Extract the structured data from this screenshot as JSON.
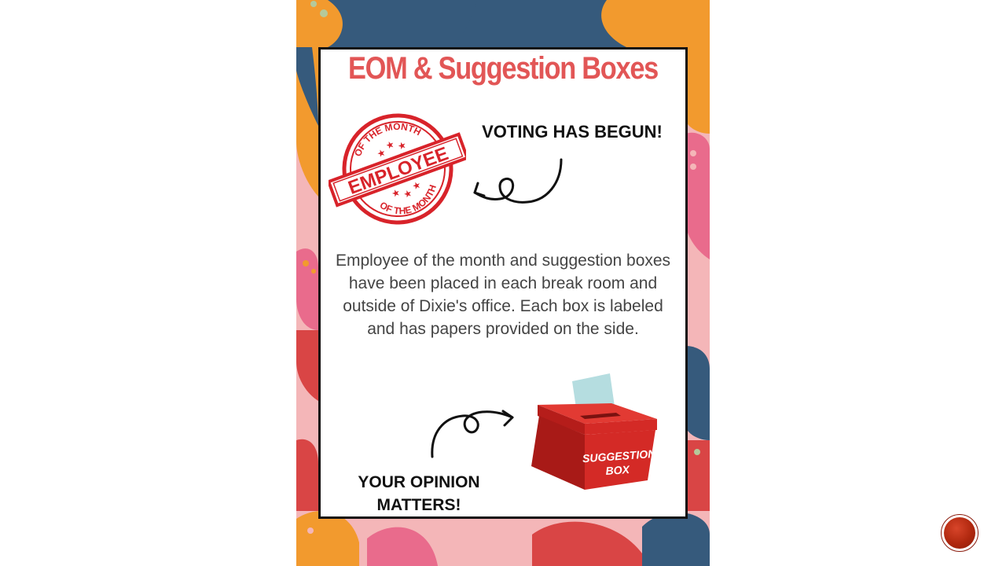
{
  "slide": {
    "poster": {
      "title": "EOM & Suggestion Boxes",
      "voting_text": "VOTING HAS BEGUN!",
      "body_text": "Employee of the month and suggestion boxes have been placed in each break room and outside of Dixie's office. Each box is labeled and has papers provided on the side.",
      "opinion_line1": "YOUR OPINION",
      "opinion_line2": "MATTERS!",
      "stamp": {
        "top_arc": "OF THE MONTH",
        "banner": "EMPLOYEE",
        "bottom_arc": "OF THE MONTH"
      },
      "ballot_label_line1": "SUGGESTION",
      "ballot_label_line2": "BOX"
    },
    "colors": {
      "title": "#e25656",
      "stamp": "#d8232a",
      "navy": "#365a7c",
      "orange": "#f29a2e",
      "pink": "#f4b6b8",
      "hot_pink": "#e96b8c",
      "red": "#d94545",
      "ballot_red": "#d42a26",
      "ballot_paper": "#b5dde0",
      "nav_button": "#b0280f"
    }
  }
}
